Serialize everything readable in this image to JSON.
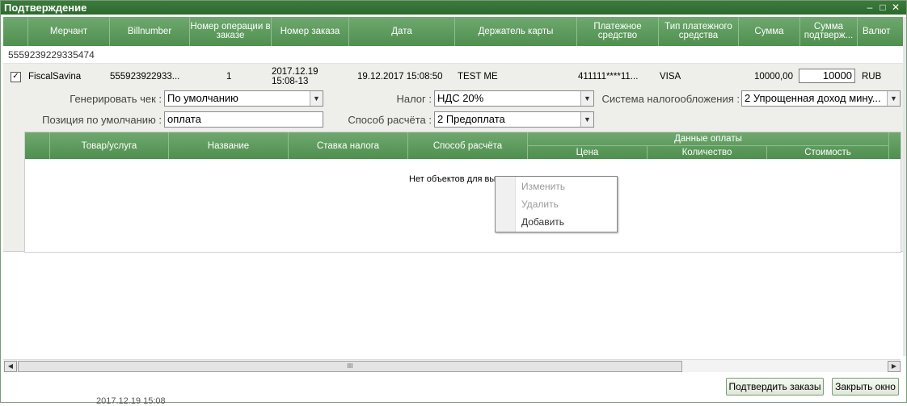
{
  "window": {
    "title": "Подтверждение"
  },
  "columns": [
    "Мерчант",
    "Billnumber",
    "Номер операции в заказе",
    "Номер заказа",
    "Дата",
    "Держатель карты",
    "Платежное средство",
    "Тип платежного средства",
    "Сумма",
    "Сумма подтверж...",
    "Валют"
  ],
  "group_label": "5559239229335474",
  "row": {
    "checked": "✓",
    "merchant": "FiscalSavina",
    "billnumber": "555923922933...",
    "op_number": "1",
    "order_number_line1": "2017.12.19",
    "order_number_line2": "15:08-13",
    "date": "19.12.2017 15:08:50",
    "holder": "TEST ME",
    "pan": "411111****11...",
    "pay_type": "VISA",
    "amount": "10000,00",
    "confirm_amount": "10000",
    "currency": "RUB"
  },
  "form": {
    "gen_check_label": "Генерировать чек :",
    "gen_check_value": "По умолчанию",
    "tax_label": "Налог :",
    "tax_value": "НДС 20%",
    "tax_system_label": "Система налогообложения :",
    "tax_system_value": "2 Упрощенная доход мину...",
    "default_position_label": "Позиция по умолчанию :",
    "default_position_value": "оплата",
    "payment_method_label": "Способ расчёта :",
    "payment_method_value": "2 Предоплата"
  },
  "items_table": {
    "columns": [
      "Товар/услуга",
      "Название",
      "Ставка налога",
      "Способ расчёта"
    ],
    "group": "Данные оплаты",
    "sub_columns": [
      "Цена",
      "Количество",
      "Стоимость"
    ],
    "empty_text": "Нет объектов для вы"
  },
  "context_menu": {
    "items": [
      "Изменить",
      "Удалить",
      "Добавить"
    ]
  },
  "buttons": {
    "confirm": "Подтвердить заказы",
    "close": "Закрыть окно"
  },
  "scroll": {
    "thumb_grip": "III"
  },
  "ghost_text": "2017.12.19 15:08"
}
